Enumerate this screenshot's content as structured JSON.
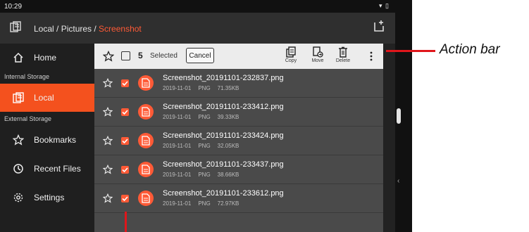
{
  "status": {
    "time": "10:29"
  },
  "appbar": {
    "breadcrumb_prefix": "Local / Pictures / ",
    "breadcrumb_current": "Screenshot",
    "icon": "local-storage-icon",
    "new_folder_icon": "new-folder-icon"
  },
  "sidebar": {
    "home": "Home",
    "internal_storage": "Internal Storage",
    "local": "Local",
    "external_storage": "External Storage",
    "bookmarks": "Bookmarks",
    "recent": "Recent Files",
    "settings": "Settings"
  },
  "actionbar": {
    "count": "5",
    "selected_label": "Selected",
    "cancel": "Cancel",
    "copy": "Copy",
    "move": "Move",
    "delete": "Delete"
  },
  "files": [
    {
      "name": "Screenshot_20191101-232837.png",
      "date": "2019-11-01",
      "type": "PNG",
      "size": "71.35KB"
    },
    {
      "name": "Screenshot_20191101-233412.png",
      "date": "2019-11-01",
      "type": "PNG",
      "size": "39.33KB"
    },
    {
      "name": "Screenshot_20191101-233424.png",
      "date": "2019-11-01",
      "type": "PNG",
      "size": "32.05KB"
    },
    {
      "name": "Screenshot_20191101-233437.png",
      "date": "2019-11-01",
      "type": "PNG",
      "size": "38.66KB"
    },
    {
      "name": "Screenshot_20191101-233612.png",
      "date": "2019-11-01",
      "type": "PNG",
      "size": "72.97KB"
    }
  ],
  "callout": {
    "label": "Action bar"
  },
  "colors": {
    "accent": "#ff5a36",
    "callout": "#e0161b"
  }
}
